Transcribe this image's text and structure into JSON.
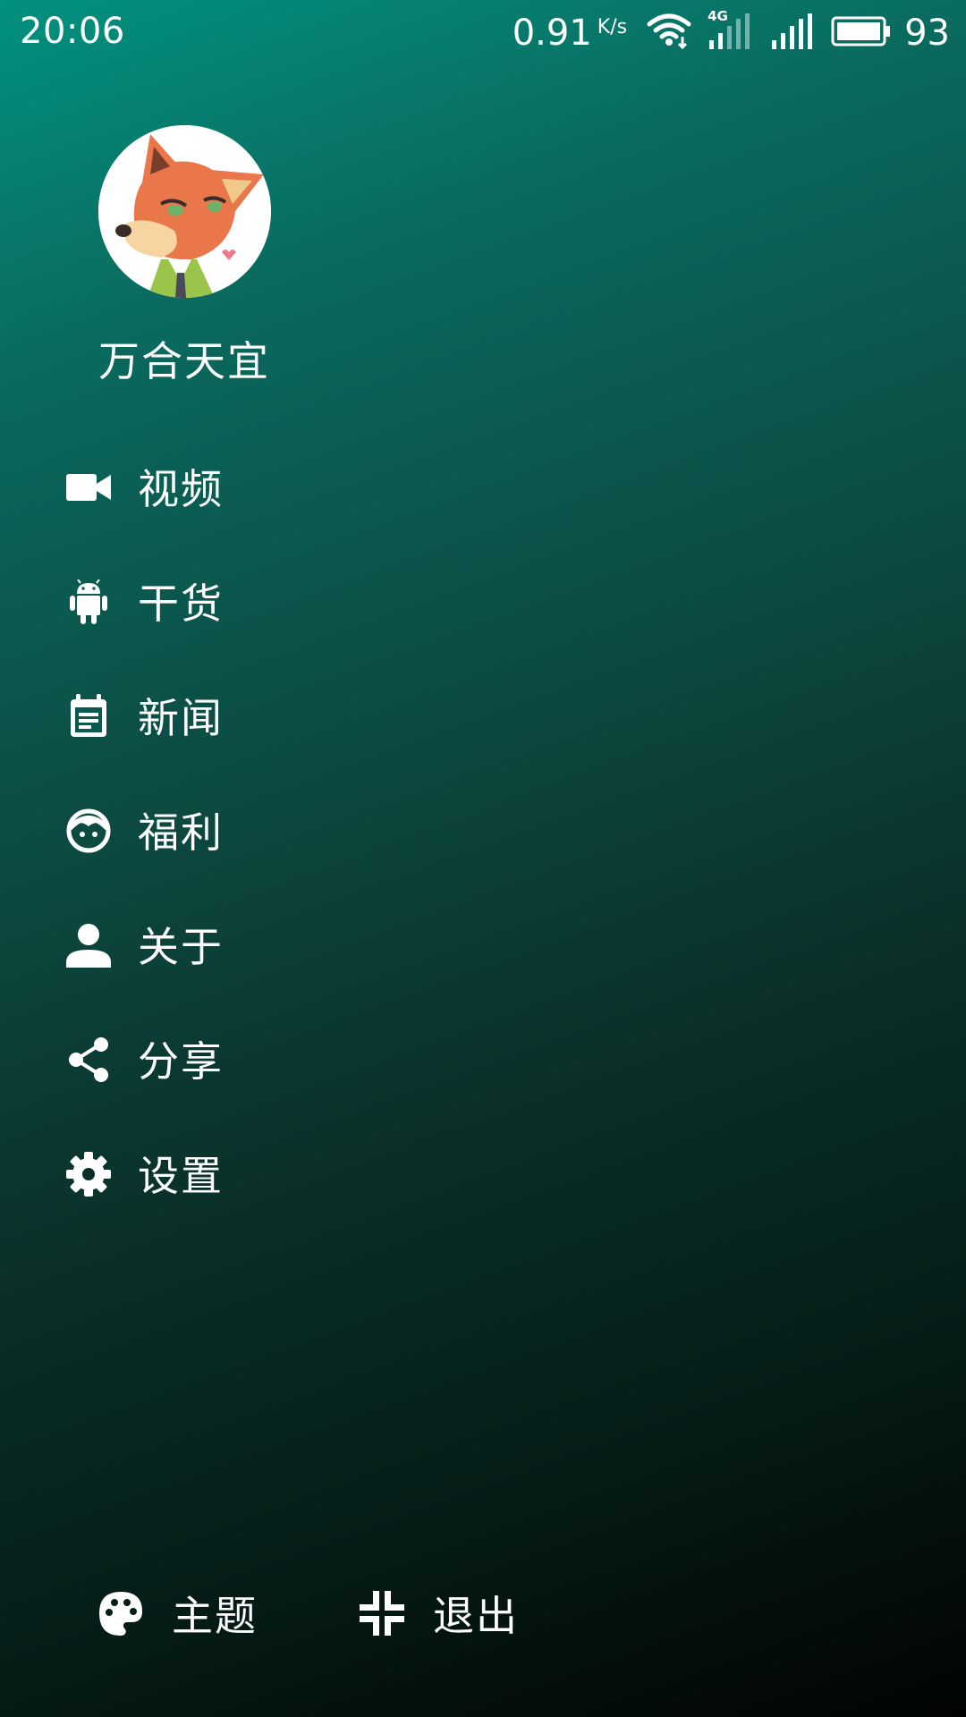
{
  "status_bar": {
    "time": "20:06",
    "net_speed": "0.91",
    "net_unit": "K/s",
    "network_type": "4G",
    "battery": "93",
    "icons": [
      "wifi-icon",
      "signal-4g-icon",
      "signal-icon",
      "battery-icon"
    ]
  },
  "header": {
    "avatar_icon": "fox-avatar",
    "username": "万合天宜"
  },
  "menu": {
    "items": [
      {
        "label": "视频",
        "icon": "videocam-icon"
      },
      {
        "label": "干货",
        "icon": "android-icon"
      },
      {
        "label": "新闻",
        "icon": "calendar-note-icon"
      },
      {
        "label": "福利",
        "icon": "face-icon"
      },
      {
        "label": "关于",
        "icon": "person-icon"
      },
      {
        "label": "分享",
        "icon": "share-icon"
      },
      {
        "label": "设置",
        "icon": "gear-icon"
      }
    ]
  },
  "bottom": {
    "theme_label": "主题",
    "theme_icon": "palette-icon",
    "exit_label": "退出",
    "exit_icon": "fullscreen-exit-icon"
  },
  "colors": {
    "gradient_top": "#02917f",
    "gradient_bottom": "#020403",
    "text": "#ffffff"
  }
}
